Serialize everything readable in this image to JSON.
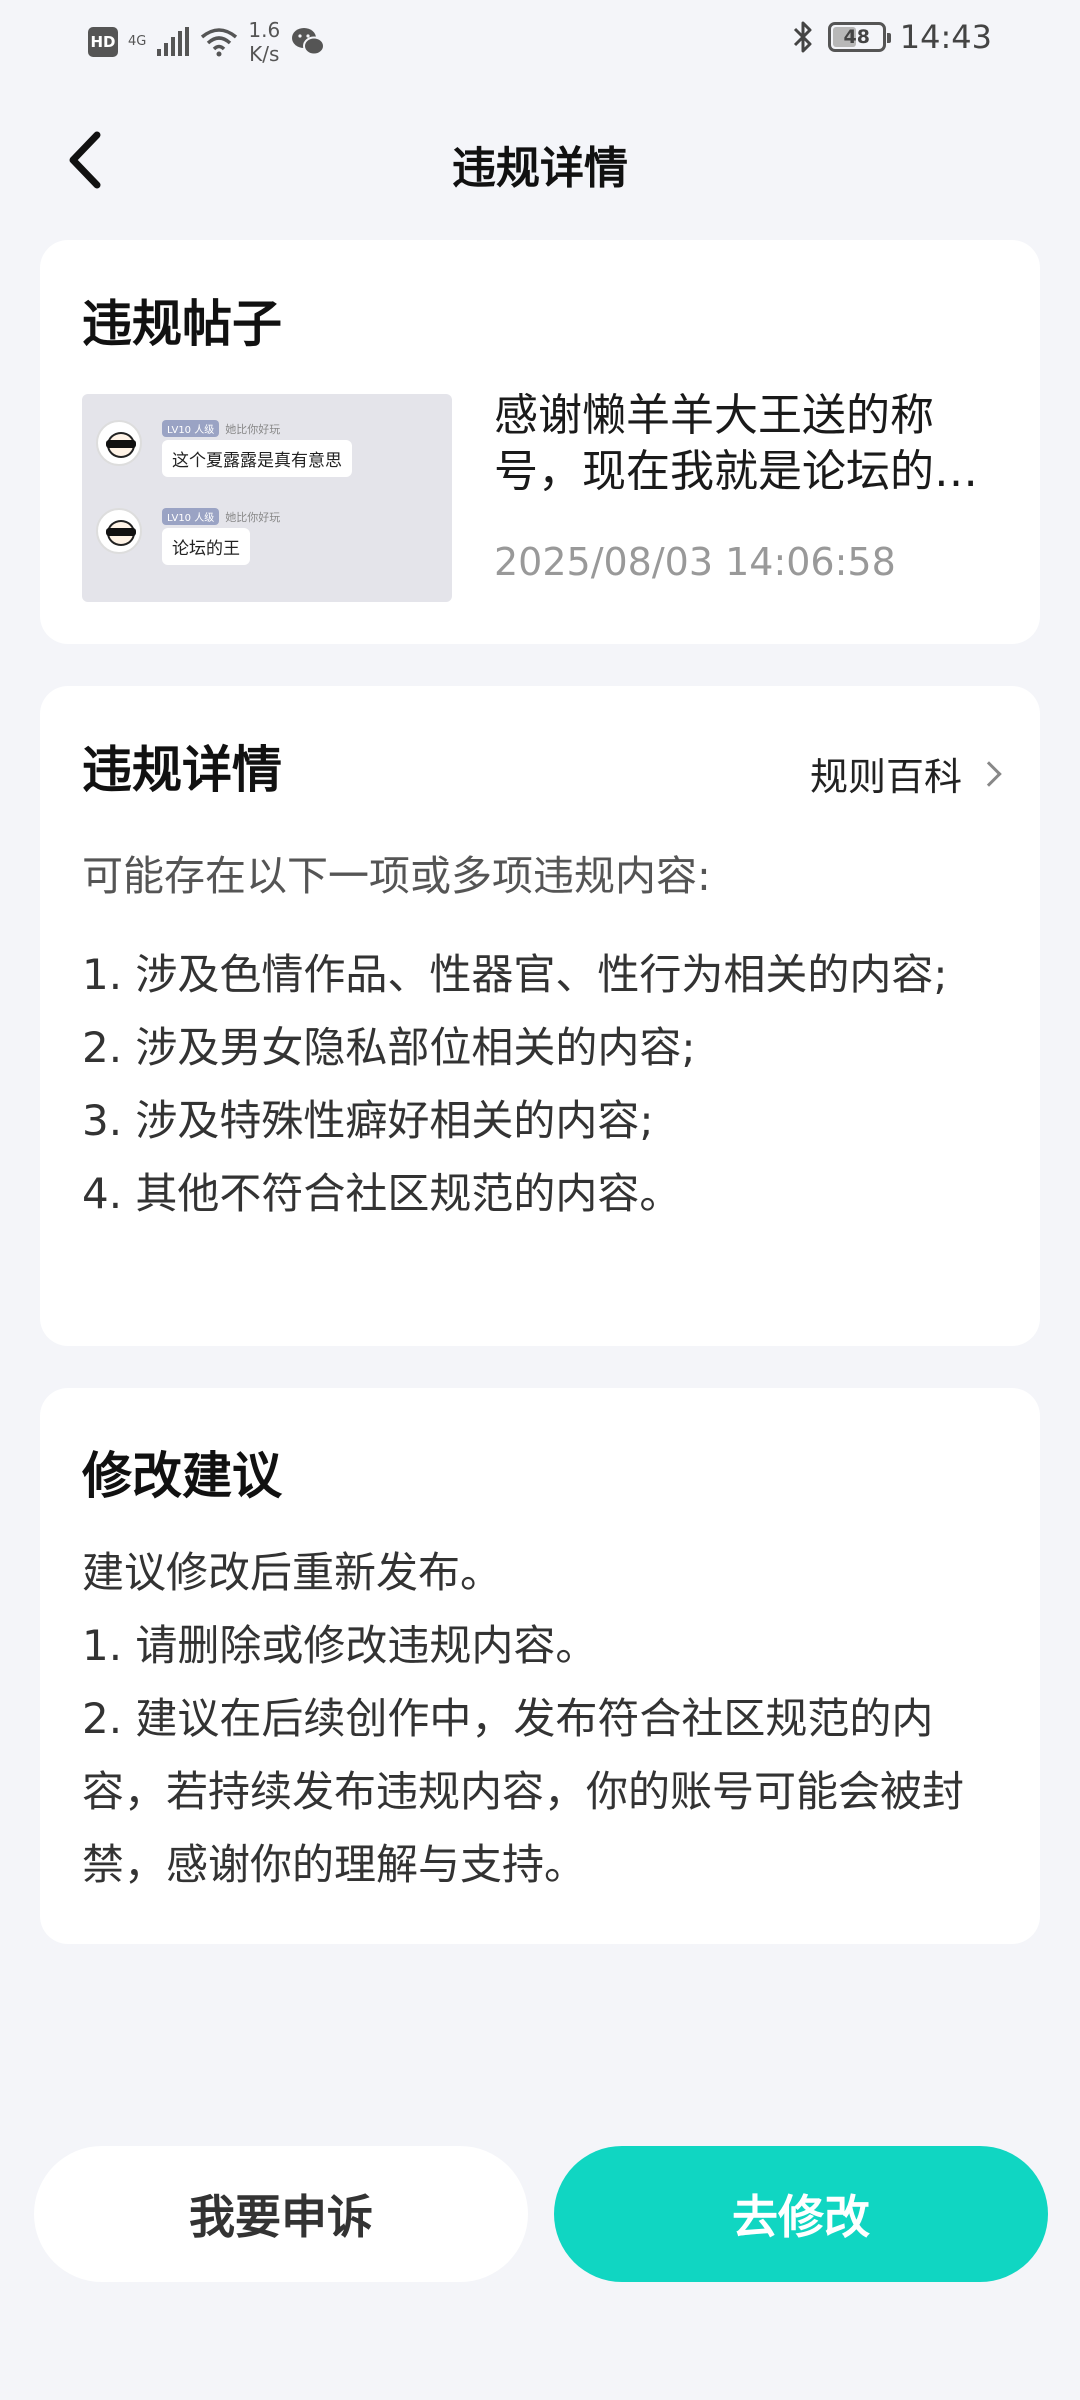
{
  "status_bar": {
    "hd": "HD",
    "network": "4G",
    "speed_value": "1.6",
    "speed_unit": "K/s",
    "battery": "48",
    "battery_level": 0.48,
    "time": "14:43"
  },
  "header": {
    "title": "违规详情"
  },
  "post_card": {
    "title": "违规帖子",
    "thumbnail": {
      "level_badge": "LV10 人级",
      "user_name": "她比你好玩",
      "message_1": "这个夏露露是真有意思",
      "message_2": "论坛的王"
    },
    "post_title": "感谢懒羊羊大王送的称号，现在我就是论坛的王了",
    "post_time": "2025/08/03 14:06:58"
  },
  "detail_card": {
    "title": "违规详情",
    "rules_link": "规则百科",
    "intro": "可能存在以下一项或多项违规内容:",
    "items": [
      "1. 涉及色情作品、性器官、性行为相关的内容;",
      "2. 涉及男女隐私部位相关的内容;",
      "3. 涉及特殊性癖好相关的内容;",
      "4. 其他不符合社区规范的内容。"
    ]
  },
  "suggest_card": {
    "title": "修改建议",
    "lines": [
      "建议修改后重新发布。",
      "1. 请删除或修改违规内容。",
      "2. 建议在后续创作中，发布符合社区规范的内容，若持续发布违规内容，你的账号可能会被封禁，感谢你的理解与支持。"
    ]
  },
  "buttons": {
    "appeal": "我要申诉",
    "modify": "去修改"
  },
  "colors": {
    "background": "#f4f5f9",
    "accent": "#10d6c2",
    "card": "#ffffff"
  }
}
